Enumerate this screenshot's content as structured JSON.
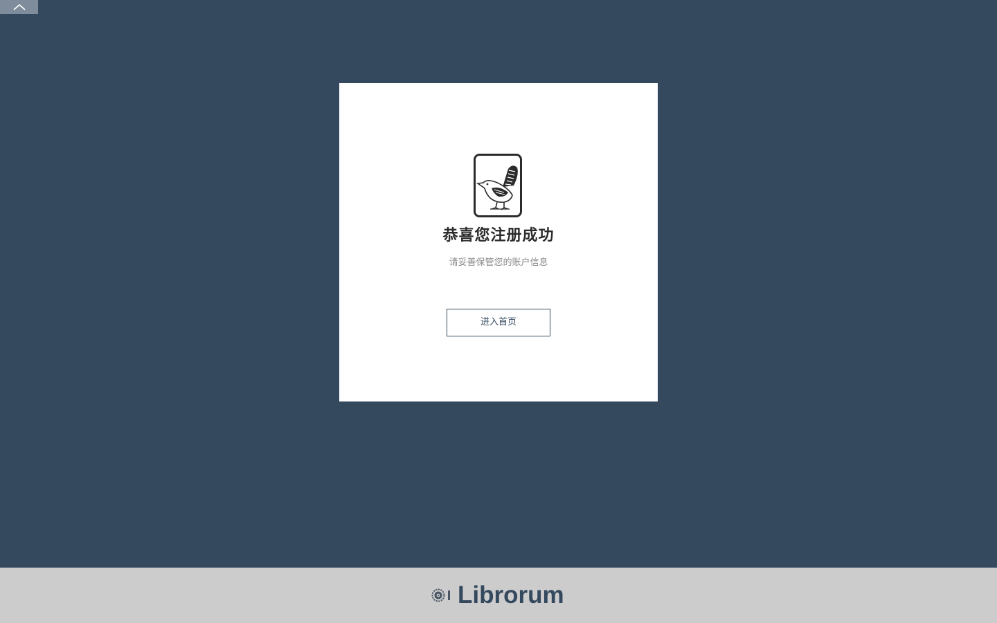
{
  "top_tab": {
    "icon": "chevron-up-icon"
  },
  "card": {
    "logo_icon": "bird-logo-icon",
    "title": "恭喜您注册成功",
    "subtitle": "请妥善保管您的账户信息",
    "home_button_label": "进入首页"
  },
  "footer": {
    "brand_icon": "librorum-logo-icon",
    "brand_name": "Librorum"
  },
  "colors": {
    "background": "#34495e",
    "card": "#ffffff",
    "footer": "#cccccd",
    "accent": "#34495e"
  }
}
